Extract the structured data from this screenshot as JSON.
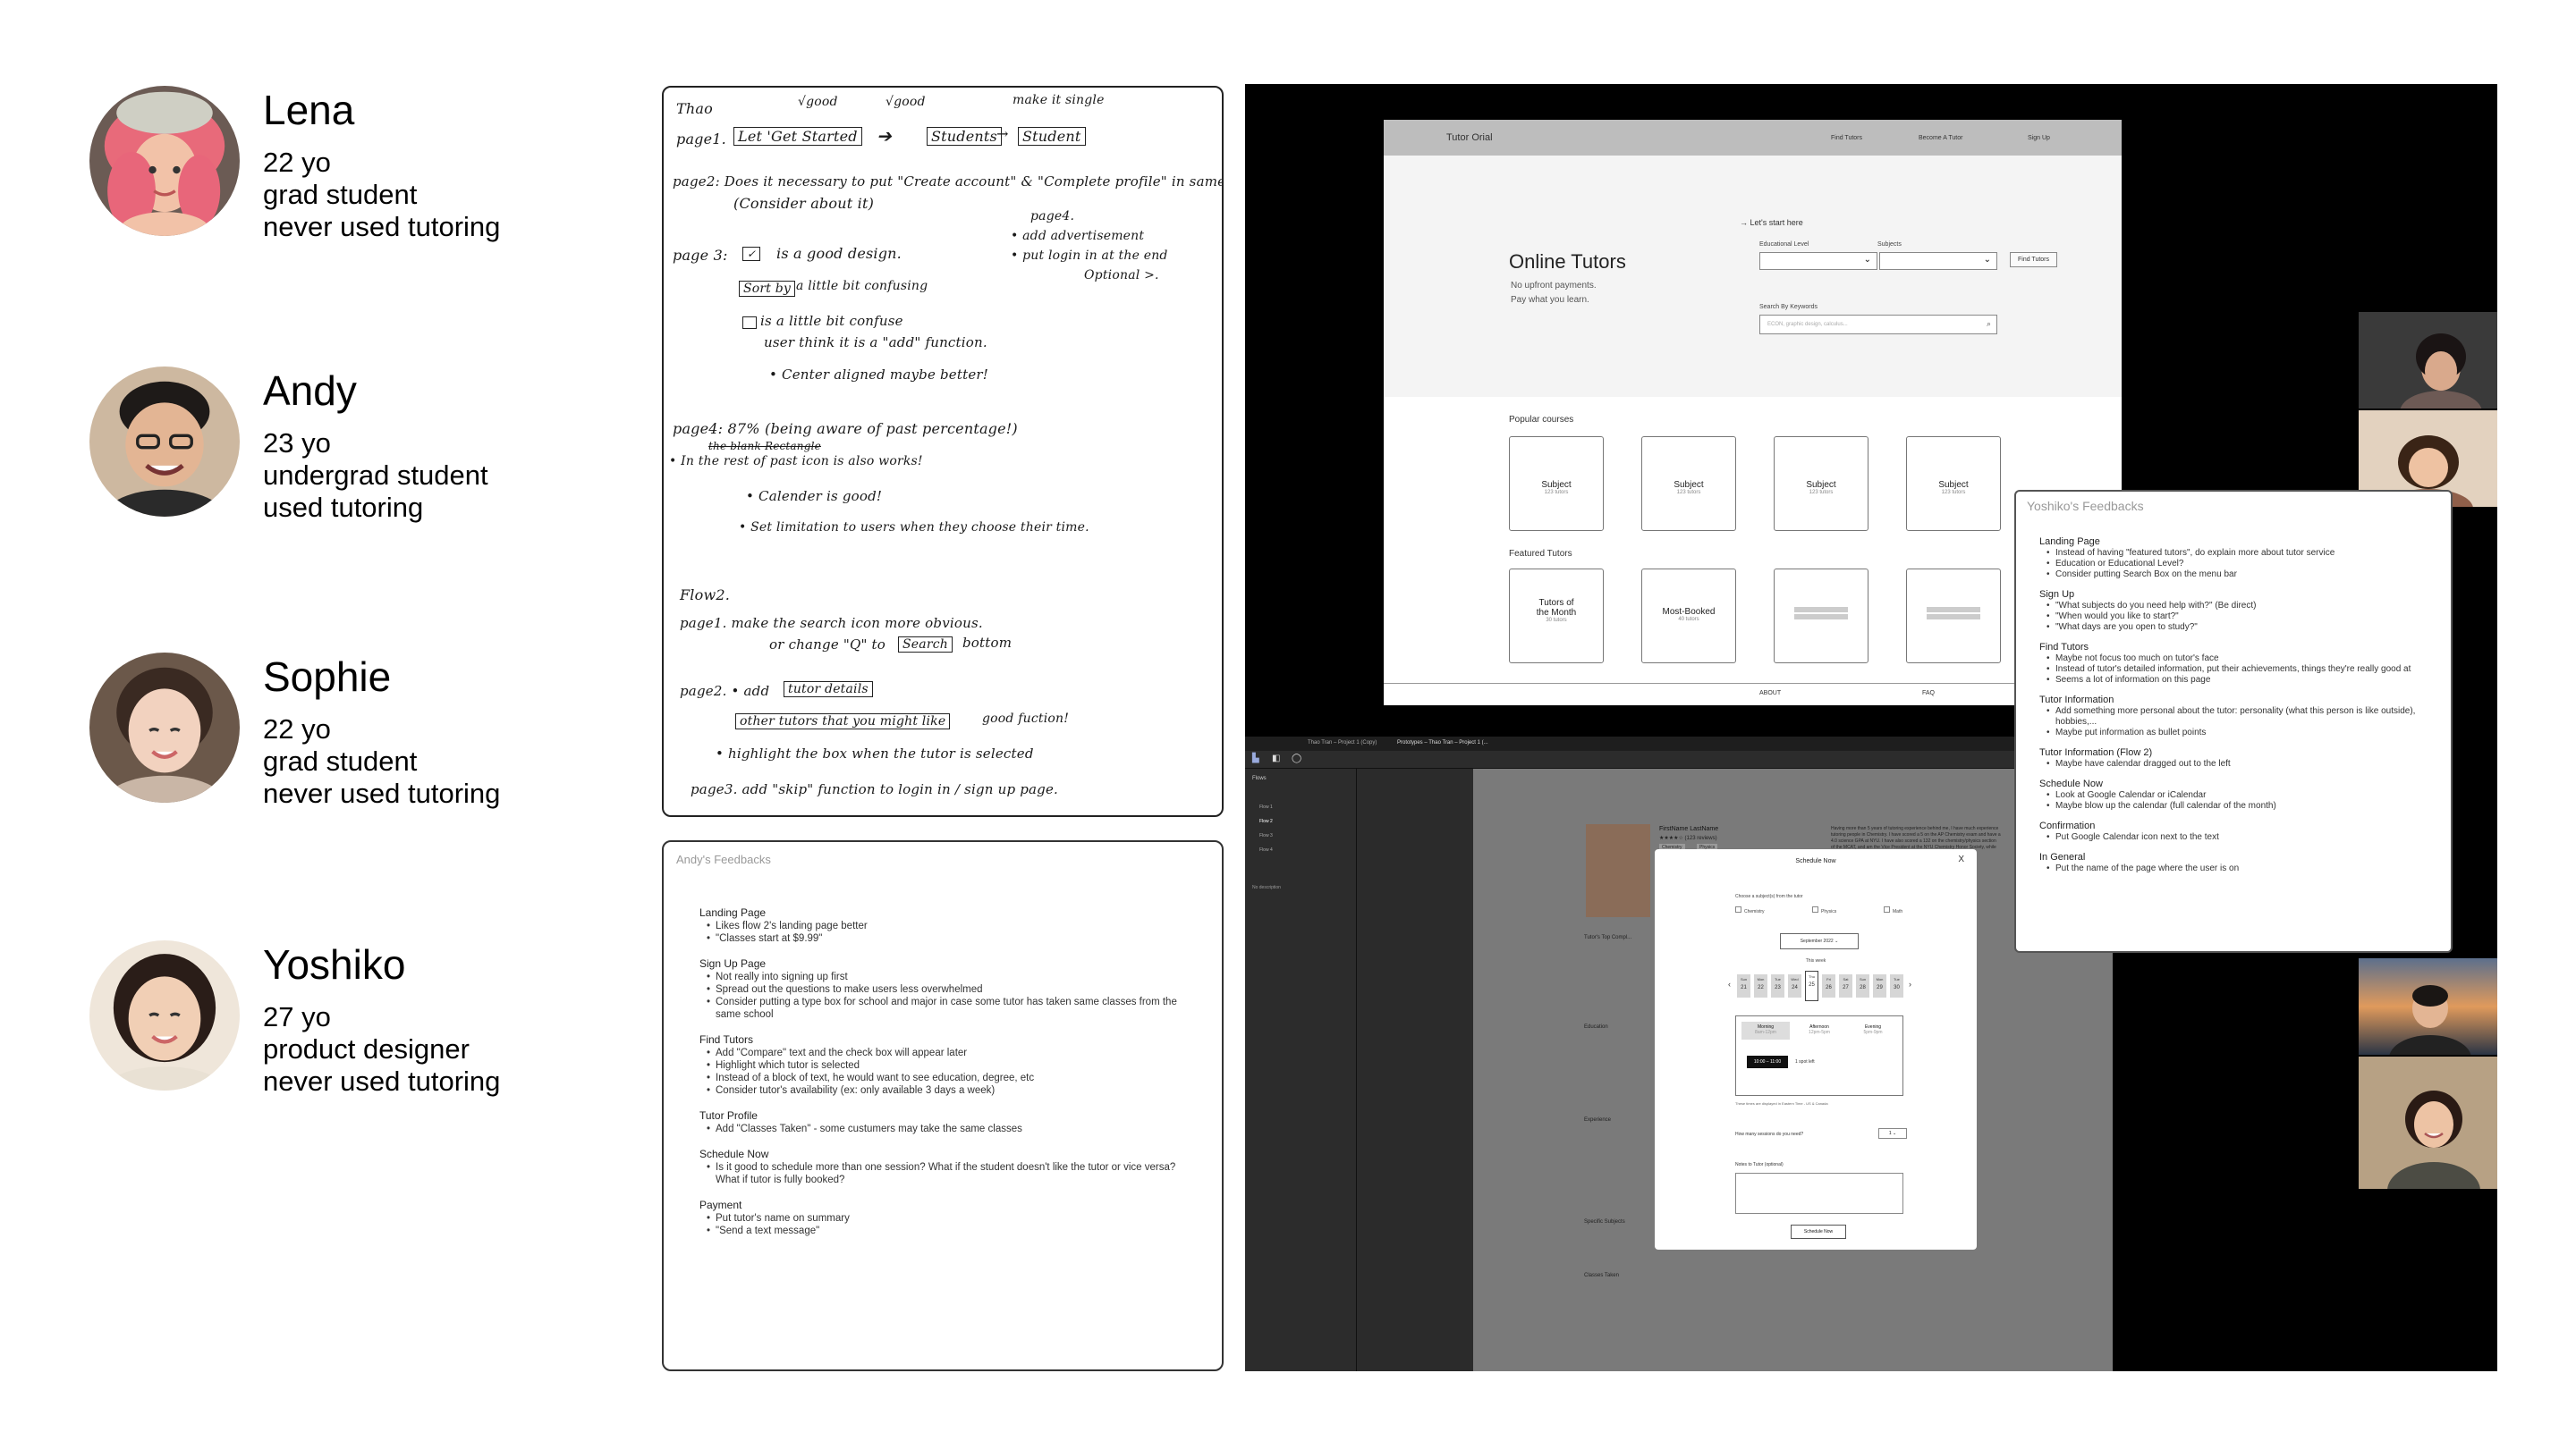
{
  "personas": [
    {
      "name": "Lena",
      "age": "22 yo",
      "role": "grad student",
      "experience": "never used tutoring"
    },
    {
      "name": "Andy",
      "age": "23 yo",
      "role": "undergrad student",
      "experience": "used tutoring"
    },
    {
      "name": "Sophie",
      "age": "22 yo",
      "role": "grad student",
      "experience": "never used tutoring"
    },
    {
      "name": "Yoshiko",
      "age": "27 yo",
      "role": "product designer",
      "experience": "never used tutoring"
    }
  ],
  "notes": {
    "author": "Thao",
    "good1": "√good",
    "good2": "√good",
    "make_single": "make it single",
    "page1_label": "page1.",
    "p1_box1": "Let 'Get Started",
    "p1_box2": "Students",
    "p1_box3": "Student",
    "page2": "page2: Does it necessary to put \"Create account\" & \"Complete profile\" in same page",
    "page2b": "(Consider about it)",
    "p4_side1": "page4.",
    "p4_side2": "• add advertisement",
    "p4_side3": "• put login in at the end",
    "p4_side4": "Optional >.",
    "page3": "page 3:",
    "page3a": "is a good design.",
    "page3b_box": "Sort by",
    "page3b": "a little bit confusing",
    "page3c": "is a little bit confuse",
    "page3d": "user think it is a \"add\" function.",
    "page3e": "• Center aligned maybe better!",
    "page4": "page4:  87% (being aware of past percentage!)",
    "page4b": "the blank Rectangle",
    "page4c": "• In the rest of past icon is also works!",
    "page4d": "• Calender is good!",
    "page4e": "• Set limitation to users when they choose their time.",
    "flow2": "Flow2.",
    "f2p1": "page1.  make the search icon more obvious.",
    "f2p1b": "or change \"Q\" to",
    "f2p1b_box": "Search",
    "f2p1c": "bottom",
    "f2p2": "page2.  • add",
    "f2p2_box": "tutor details",
    "f2p2b_box": "other tutors that you might like",
    "f2p2b": "good fuction!",
    "f2p2c": "• highlight the box when the tutor is selected",
    "f2p3": "page3.  add \"skip\" function to login in / sign up page."
  },
  "andy_feedback": {
    "title": "Andy's Feedbacks",
    "sections": [
      {
        "head": "Landing Page",
        "items": [
          "Likes flow 2's landing page better",
          "\"Classes start at $9.99\""
        ]
      },
      {
        "head": "Sign Up Page",
        "items": [
          "Not really into signing up first",
          "Spread out the questions to make users less overwhelmed",
          "Consider putting a type box for school and major in case some tutor has taken same classes from the same school"
        ]
      },
      {
        "head": "Find Tutors",
        "items": [
          "Add \"Compare\" text and the check box will appear later",
          "Highlight which tutor is selected",
          "Instead of a block of text, he would want to see education, degree, etc",
          "Consider tutor's availability (ex: only available 3 days a week)"
        ]
      },
      {
        "head": "Tutor Profile",
        "items": [
          "Add \"Classes Taken\" - some custumers may take the same classes"
        ]
      },
      {
        "head": "Schedule Now",
        "items": [
          "Is it good to schedule more than one session? What if the student doesn't like the tutor or vice versa? What if tutor is fully booked?"
        ]
      },
      {
        "head": "Payment",
        "items": [
          "Put tutor's name on summary",
          "\"Send a text message\""
        ]
      }
    ]
  },
  "prototype": {
    "brand": "Tutor Orial",
    "nav": [
      "Find Tutors",
      "Become A Tutor",
      "Sign Up"
    ],
    "lets_start": "→  Let's start here",
    "hero_title": "Online Tutors",
    "hero_sub1": "No upfront payments.",
    "hero_sub2": "Pay what you learn.",
    "edu_label": "Educational Level",
    "subj_label": "Subjects",
    "find_button": "Find Tutors",
    "search_label": "Search By Keywords",
    "search_placeholder": "ECON, graphic design, calculus...",
    "popular_label": "Popular courses",
    "popular": [
      {
        "name": "Subject",
        "count": "123 tutors"
      },
      {
        "name": "Subject",
        "count": "123 tutors"
      },
      {
        "name": "Subject",
        "count": "123 tutors"
      },
      {
        "name": "Subject",
        "count": "123 tutors"
      }
    ],
    "featured_label": "Featured Tutors",
    "featured1_a": "Tutors of",
    "featured1_b": "the Month",
    "featured1_c": "30 tutors",
    "featured2": "Most-Booked",
    "featured2_c": "40 tutors",
    "footer": [
      "ABOUT",
      "FAQ"
    ]
  },
  "figma": {
    "tab1": "Thao Tran – Project 1 (Copy)",
    "tab2": "Prototypes – Thao Tran – Project 1 (...",
    "flows_label": "Flows",
    "flows": [
      "Flow 1",
      "Flow 2",
      "Flow 3",
      "Flow 4"
    ],
    "no_description": "No description",
    "tutor_name": "FirstName LastName",
    "tutor_rating": "★★★★☆ (123 reviews)",
    "tutor_tags": [
      "Chemistry",
      "Physics"
    ],
    "tutor_bio": "Having more than 5 years of tutoring experience behind me, I have much experience tutoring people in Chemistry. I have scored a 5 on the AP Chemistry exam and have a 4.0 science GPA at NYU. I have also scored a 132 on the chemistry/physics section of the MCAT, and am the Vice President at the NYU Chemistry Honor Society, while looking at",
    "top_comp": "Tutor's Top Compl...",
    "education": "Education",
    "experience": "Experience",
    "specific_subjects": "Specific Subjects",
    "classes_taken": "Classes Taken",
    "modal_title": "Schedule Now",
    "modal_close": "X",
    "choose_subject": "Choose a subject(s) from the tutor",
    "subjects": [
      "Chemistry",
      "Physics",
      "Math"
    ],
    "month": "September 2022",
    "this_week": "This week",
    "days": [
      "21",
      "22",
      "23",
      "24",
      "25",
      "26",
      "27",
      "28",
      "29",
      "30"
    ],
    "dows": [
      "Sun",
      "Mon",
      "Tue",
      "Wed",
      "Thu",
      "Fri",
      "Sat",
      "Sun",
      "Mon",
      "Tue"
    ],
    "times": [
      "Morning",
      "Afternoon",
      "Evening"
    ],
    "time_sub": [
      "8am-12pm",
      "12pm-5pm",
      "5pm-9pm"
    ],
    "slot": "10:00 – 11:00",
    "slot_left": "1 spot left",
    "timezone": "These times are displayed in Eastern Time - US & Canada",
    "sessions_q": "How many sessions do you need?",
    "sessions_val": "1",
    "note_label": "Notes to Tutor (optional)",
    "schedule_btn": "Schedule Now"
  },
  "yoshiko_feedback": {
    "title": "Yoshiko's Feedbacks",
    "sections": [
      {
        "head": "Landing Page",
        "items": [
          "Instead of having \"featured tutors\", do explain more about tutor service",
          "Education or Educational Level?",
          "Consider putting Search Box on the menu bar"
        ]
      },
      {
        "head": "Sign Up",
        "items": [
          "\"What subjects do you need help with?\" (Be direct)",
          "\"When would you like to start?\"",
          "\"What days are you open to study?\""
        ]
      },
      {
        "head": "Find Tutors",
        "items": [
          "Maybe not focus too much on tutor's face",
          "Instead of tutor's detailed information, put their achievements, things they're really good at",
          "Seems a lot of information on this page"
        ]
      },
      {
        "head": "Tutor Information",
        "items": [
          "Add something more personal about the tutor: personality (what this person is like outside), hobbies,...",
          "Maybe put information as bullet points"
        ]
      },
      {
        "head": "Tutor Information (Flow 2)",
        "items": [
          "Maybe have calendar dragged out to the left"
        ]
      },
      {
        "head": "Schedule Now",
        "items": [
          "Look at Google Calendar or iCalendar",
          "Maybe blow up the calendar (full calendar of the month)"
        ]
      },
      {
        "head": "Confirmation",
        "items": [
          "Put Google Calendar icon next to the text"
        ]
      },
      {
        "head": "In General",
        "items": [
          "Put the name of the page where the user is on"
        ]
      }
    ]
  },
  "colors": {
    "page_bg": "#ffffff",
    "call_bg": "#000000",
    "wire_nav": "#bdbdbd",
    "figma_dark": "#2b2b2b"
  }
}
